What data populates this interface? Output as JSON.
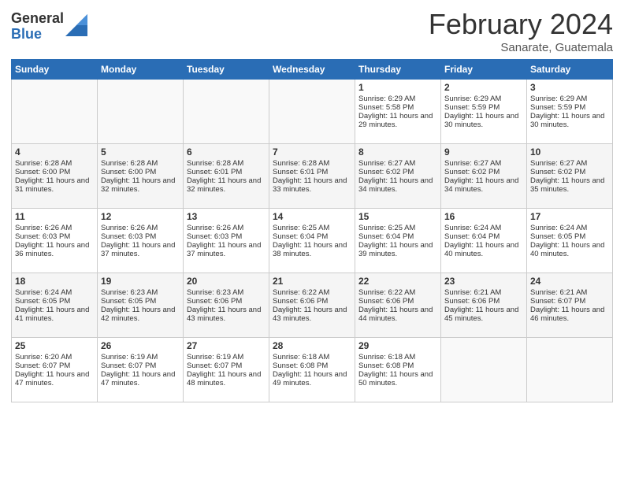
{
  "logo": {
    "general": "General",
    "blue": "Blue"
  },
  "title": "February 2024",
  "location": "Sanarate, Guatemala",
  "days_of_week": [
    "Sunday",
    "Monday",
    "Tuesday",
    "Wednesday",
    "Thursday",
    "Friday",
    "Saturday"
  ],
  "weeks": [
    [
      {
        "day": "",
        "info": ""
      },
      {
        "day": "",
        "info": ""
      },
      {
        "day": "",
        "info": ""
      },
      {
        "day": "",
        "info": ""
      },
      {
        "day": "1",
        "info": "Sunrise: 6:29 AM\nSunset: 5:58 PM\nDaylight: 11 hours and 29 minutes."
      },
      {
        "day": "2",
        "info": "Sunrise: 6:29 AM\nSunset: 5:59 PM\nDaylight: 11 hours and 30 minutes."
      },
      {
        "day": "3",
        "info": "Sunrise: 6:29 AM\nSunset: 5:59 PM\nDaylight: 11 hours and 30 minutes."
      }
    ],
    [
      {
        "day": "4",
        "info": "Sunrise: 6:28 AM\nSunset: 6:00 PM\nDaylight: 11 hours and 31 minutes."
      },
      {
        "day": "5",
        "info": "Sunrise: 6:28 AM\nSunset: 6:00 PM\nDaylight: 11 hours and 32 minutes."
      },
      {
        "day": "6",
        "info": "Sunrise: 6:28 AM\nSunset: 6:01 PM\nDaylight: 11 hours and 32 minutes."
      },
      {
        "day": "7",
        "info": "Sunrise: 6:28 AM\nSunset: 6:01 PM\nDaylight: 11 hours and 33 minutes."
      },
      {
        "day": "8",
        "info": "Sunrise: 6:27 AM\nSunset: 6:02 PM\nDaylight: 11 hours and 34 minutes."
      },
      {
        "day": "9",
        "info": "Sunrise: 6:27 AM\nSunset: 6:02 PM\nDaylight: 11 hours and 34 minutes."
      },
      {
        "day": "10",
        "info": "Sunrise: 6:27 AM\nSunset: 6:02 PM\nDaylight: 11 hours and 35 minutes."
      }
    ],
    [
      {
        "day": "11",
        "info": "Sunrise: 6:26 AM\nSunset: 6:03 PM\nDaylight: 11 hours and 36 minutes."
      },
      {
        "day": "12",
        "info": "Sunrise: 6:26 AM\nSunset: 6:03 PM\nDaylight: 11 hours and 37 minutes."
      },
      {
        "day": "13",
        "info": "Sunrise: 6:26 AM\nSunset: 6:03 PM\nDaylight: 11 hours and 37 minutes."
      },
      {
        "day": "14",
        "info": "Sunrise: 6:25 AM\nSunset: 6:04 PM\nDaylight: 11 hours and 38 minutes."
      },
      {
        "day": "15",
        "info": "Sunrise: 6:25 AM\nSunset: 6:04 PM\nDaylight: 11 hours and 39 minutes."
      },
      {
        "day": "16",
        "info": "Sunrise: 6:24 AM\nSunset: 6:04 PM\nDaylight: 11 hours and 40 minutes."
      },
      {
        "day": "17",
        "info": "Sunrise: 6:24 AM\nSunset: 6:05 PM\nDaylight: 11 hours and 40 minutes."
      }
    ],
    [
      {
        "day": "18",
        "info": "Sunrise: 6:24 AM\nSunset: 6:05 PM\nDaylight: 11 hours and 41 minutes."
      },
      {
        "day": "19",
        "info": "Sunrise: 6:23 AM\nSunset: 6:05 PM\nDaylight: 11 hours and 42 minutes."
      },
      {
        "day": "20",
        "info": "Sunrise: 6:23 AM\nSunset: 6:06 PM\nDaylight: 11 hours and 43 minutes."
      },
      {
        "day": "21",
        "info": "Sunrise: 6:22 AM\nSunset: 6:06 PM\nDaylight: 11 hours and 43 minutes."
      },
      {
        "day": "22",
        "info": "Sunrise: 6:22 AM\nSunset: 6:06 PM\nDaylight: 11 hours and 44 minutes."
      },
      {
        "day": "23",
        "info": "Sunrise: 6:21 AM\nSunset: 6:06 PM\nDaylight: 11 hours and 45 minutes."
      },
      {
        "day": "24",
        "info": "Sunrise: 6:21 AM\nSunset: 6:07 PM\nDaylight: 11 hours and 46 minutes."
      }
    ],
    [
      {
        "day": "25",
        "info": "Sunrise: 6:20 AM\nSunset: 6:07 PM\nDaylight: 11 hours and 47 minutes."
      },
      {
        "day": "26",
        "info": "Sunrise: 6:19 AM\nSunset: 6:07 PM\nDaylight: 11 hours and 47 minutes."
      },
      {
        "day": "27",
        "info": "Sunrise: 6:19 AM\nSunset: 6:07 PM\nDaylight: 11 hours and 48 minutes."
      },
      {
        "day": "28",
        "info": "Sunrise: 6:18 AM\nSunset: 6:08 PM\nDaylight: 11 hours and 49 minutes."
      },
      {
        "day": "29",
        "info": "Sunrise: 6:18 AM\nSunset: 6:08 PM\nDaylight: 11 hours and 50 minutes."
      },
      {
        "day": "",
        "info": ""
      },
      {
        "day": "",
        "info": ""
      }
    ]
  ]
}
